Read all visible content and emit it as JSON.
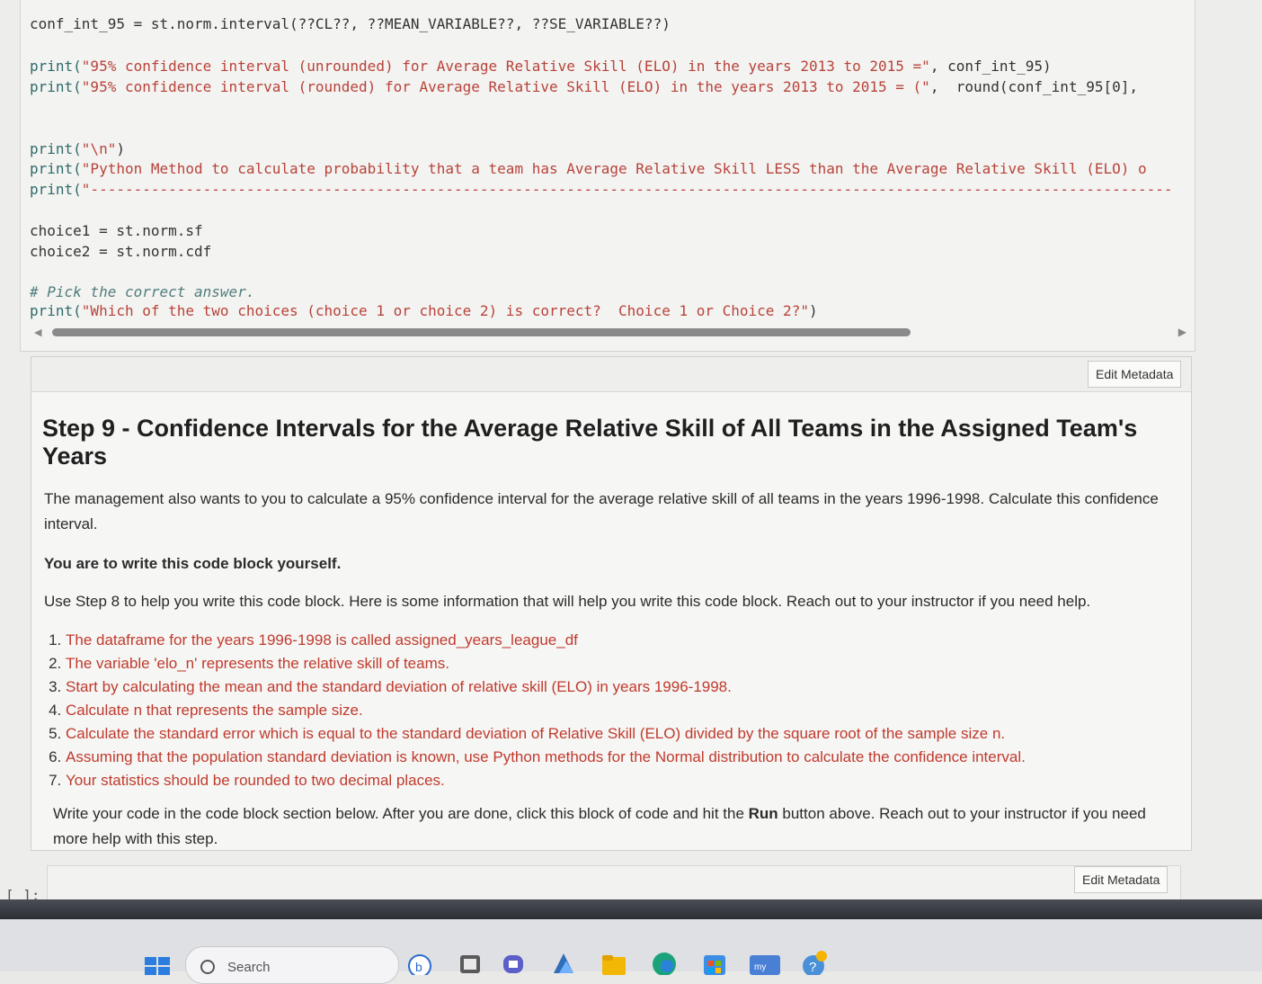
{
  "code_lines": {
    "l1": "conf_int_95 = st.norm.interval(??CL??, ??MEAN_VARIABLE??, ??SE_VARIABLE??)",
    "l2a": "print(",
    "l2b": "\"95% confidence interval (unrounded) for Average Relative Skill (ELO) in the years 2013 to 2015 =\"",
    "l2c": ", conf_int_95)",
    "l3a": "print(",
    "l3b": "\"95% confidence interval (rounded) for Average Relative Skill (ELO) in the years 2013 to 2015 = (\"",
    "l3c": ",  round(conf_int_95[0],",
    "l4a": "print(",
    "l4b": "\"\\n\"",
    "l4c": ")",
    "l5a": "print(",
    "l5b": "\"Python Method to calculate probability that a team has Average Relative Skill LESS than the Average Relative Skill (ELO) o",
    "l6a": "print(",
    "l6b": "\"-----------------------------------------------------------------------------------------------------------------------------",
    "l7": "choice1 = st.norm.sf",
    "l8": "choice2 = st.norm.cdf",
    "l9": "# Pick the correct answer.",
    "l10a": "print(",
    "l10b": "\"Which of the two choices (choice 1 or choice 2) is correct?  Choice 1 or Choice 2?\"",
    "l10c": ")"
  },
  "markdown": {
    "edit_metadata": "Edit Metadata",
    "heading": "Step 9 - Confidence Intervals for the Average Relative Skill of All Teams in the Assigned Team's Years",
    "para1": "The management also wants to you to calculate a 95% confidence interval for the average relative skill of all teams in the years 1996-1998. Calculate this confidence interval.",
    "bold_note": "You are to write this code block yourself.",
    "para2": "Use Step 8 to help you write this code block. Here is some information that will help you write this code block. Reach out to your instructor if you need help.",
    "items": [
      "The dataframe for the years 1996-1998 is called assigned_years_league_df",
      "The variable 'elo_n' represents the relative skill of teams.",
      "Start by calculating the mean and the standard deviation of relative skill (ELO) in years 1996-1998.",
      "Calculate n that represents the sample size.",
      "Calculate the standard error which is equal to the standard deviation of Relative Skill (ELO) divided by the square root of the sample size n.",
      "Assuming that the population standard deviation is known, use Python methods for the Normal distribution to calculate the confidence interval.",
      "Your statistics should be rounded to two decimal places."
    ],
    "para3_a": "Write your code in the code block section below. After you are done, click this block of code and hit the ",
    "para3_b": "Run",
    "para3_c": " button above. Reach out to your instructor if you need more help with this step."
  },
  "empty_cell": {
    "prompt": "[ ]:",
    "edit_metadata": "Edit Metadata"
  },
  "taskbar": {
    "search_placeholder": "Search",
    "icons": [
      "windows-start-icon",
      "search-icon",
      "bing-icon",
      "task-view-icon",
      "teams-chat-icon",
      "widgets-icon",
      "file-explorer-icon",
      "edge-icon",
      "store-icon",
      "mylab-icon",
      "help-icon"
    ]
  }
}
